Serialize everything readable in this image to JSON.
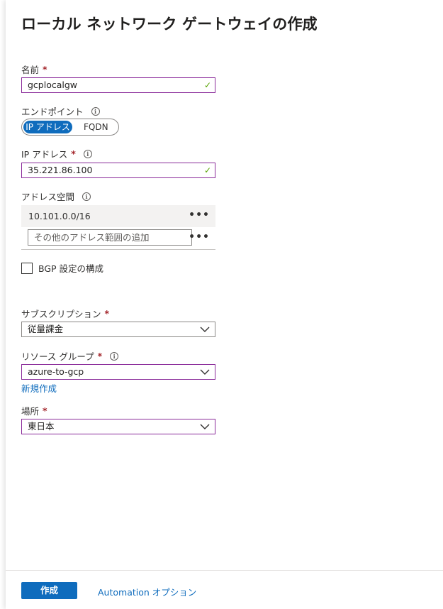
{
  "header": {
    "title": "ローカル ネットワーク ゲートウェイの作成",
    "more": "···"
  },
  "form": {
    "name": {
      "label": "名前",
      "required": "*",
      "value": "gcplocalgw",
      "valid_mark": "✓"
    },
    "endpoint": {
      "label": "エンドポイント",
      "info": "i",
      "options": [
        "IP アドレス",
        "FQDN"
      ],
      "selected": "IP アドレス"
    },
    "ip_address": {
      "label": "IP アドレス",
      "required": "*",
      "info": "i",
      "value": "35.221.86.100",
      "valid_mark": "✓"
    },
    "address_space": {
      "label": "アドレス空間",
      "info": "i",
      "rows": [
        {
          "value": "10.101.0.0/16",
          "menu": "•••"
        }
      ],
      "add_placeholder": "その他のアドレス範囲の追加",
      "add_menu": "•••"
    },
    "bgp": {
      "label": "BGP 設定の構成",
      "checked": false
    },
    "subscription": {
      "label": "サブスクリプション",
      "required": "*",
      "value": "従量課金"
    },
    "resource_group": {
      "label": "リソース グループ",
      "required": "*",
      "info": "i",
      "value": "azure-to-gcp",
      "new_link": "新規作成"
    },
    "location": {
      "label": "場所",
      "required": "*",
      "value": "東日本"
    }
  },
  "footer": {
    "create_button": "作成",
    "automation_link": "Automation オプション"
  },
  "colors": {
    "accent": "#0f6cbd",
    "focus_border": "#8a2b9a",
    "valid": "#57a300",
    "required": "#a4262c"
  }
}
